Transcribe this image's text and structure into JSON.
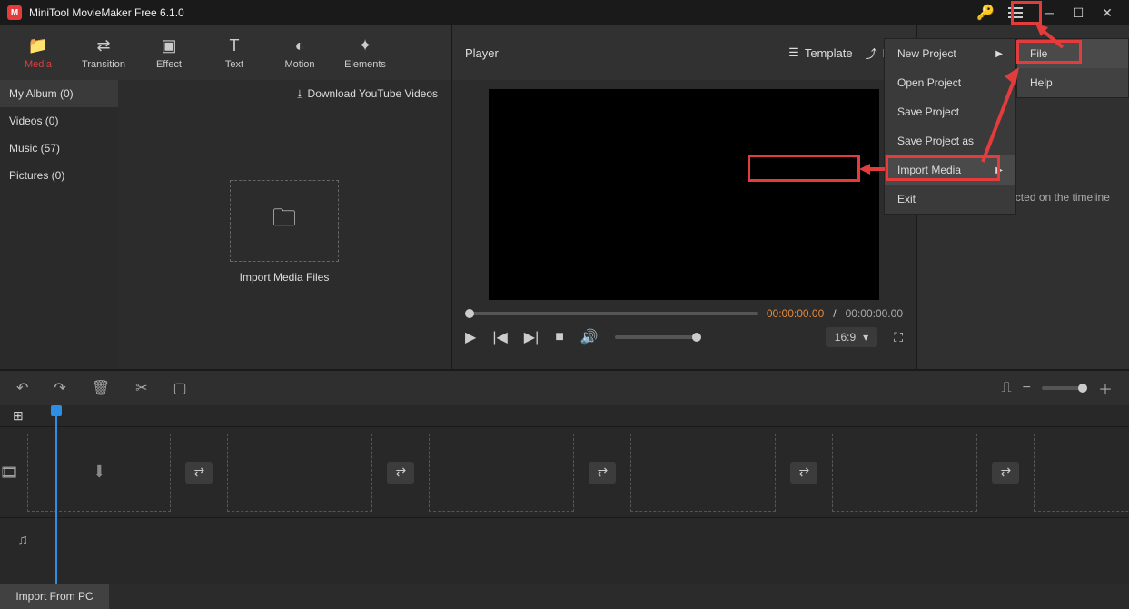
{
  "app": {
    "title": "MiniTool MovieMaker Free 6.1.0"
  },
  "tabs": {
    "media": "Media",
    "transition": "Transition",
    "effect": "Effect",
    "text": "Text",
    "motion": "Motion",
    "elements": "Elements"
  },
  "albums": {
    "my_album": "My Album (0)",
    "videos": "Videos (0)",
    "music": "Music (57)",
    "pictures": "Pictures (0)"
  },
  "download_yt": "Download YouTube Videos",
  "import_box_label": "Import Media Files",
  "player": {
    "title": "Player",
    "template": "Template",
    "export": "Exp",
    "cur_time": "00:00:00.00",
    "sep": "/",
    "duration": "00:00:00.00",
    "aspect": "16:9"
  },
  "props_empty": "No material selected on the timeline",
  "menu_main": {
    "new_project": "New Project",
    "open_project": "Open Project",
    "save_project": "Save Project",
    "save_project_as": "Save Project as",
    "import_media": "Import Media",
    "exit": "Exit"
  },
  "menu_side": {
    "file": "File",
    "help": "Help"
  },
  "submenu_import_pc": "Import From PC"
}
